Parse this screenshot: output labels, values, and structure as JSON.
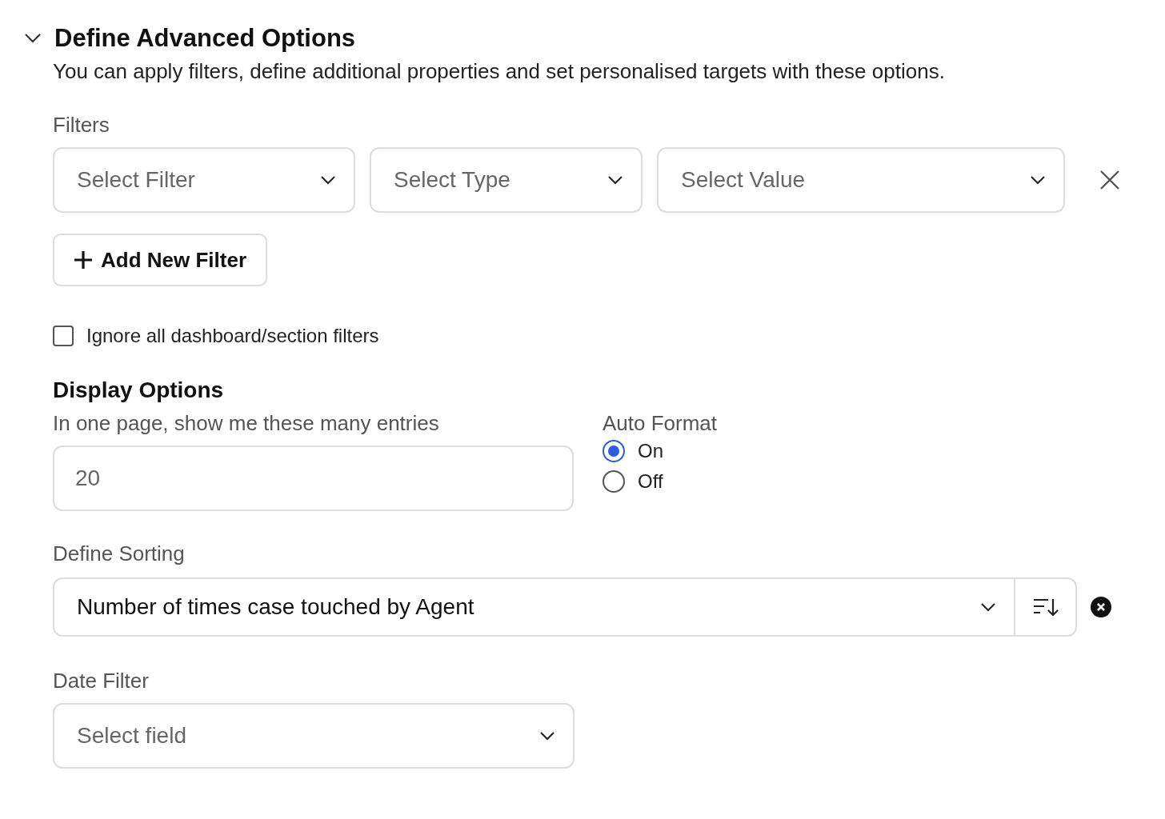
{
  "section": {
    "title": "Define Advanced Options",
    "expanded": true,
    "description": "You can apply filters, define additional properties and set personalised targets with these options."
  },
  "filters": {
    "label": "Filters",
    "selects": [
      {
        "placeholder": "Select Filter"
      },
      {
        "placeholder": "Select Type"
      },
      {
        "placeholder": "Select Value"
      }
    ],
    "add_button": "Add New Filter"
  },
  "ignore_filters": {
    "label": "Ignore all dashboard/section filters",
    "checked": false
  },
  "display_options": {
    "title": "Display Options",
    "entries_label": "In one page, show me these many entries",
    "entries_placeholder": "20",
    "auto_format": {
      "label": "Auto Format",
      "options": [
        {
          "label": "On",
          "selected": true
        },
        {
          "label": "Off",
          "selected": false
        }
      ]
    }
  },
  "sorting": {
    "label": "Define Sorting",
    "value": "Number of times case touched by Agent"
  },
  "date_filter": {
    "label": "Date Filter",
    "placeholder": "Select field"
  }
}
